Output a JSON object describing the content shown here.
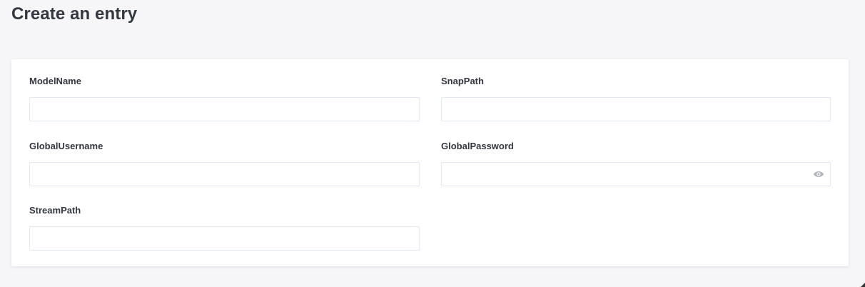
{
  "header": {
    "title": "Create an entry"
  },
  "form": {
    "fields": [
      {
        "label": "ModelName",
        "value": "",
        "placeholder": ""
      },
      {
        "label": "SnapPath",
        "value": "",
        "placeholder": ""
      },
      {
        "label": "GlobalUsername",
        "value": "",
        "placeholder": ""
      },
      {
        "label": "GlobalPassword",
        "value": "",
        "placeholder": "",
        "icon": "eye-icon"
      },
      {
        "label": "StreamPath",
        "value": "",
        "placeholder": ""
      }
    ]
  },
  "colors": {
    "background": "#f6f6f9",
    "card": "#ffffff",
    "input_border": "#e3e9f3",
    "text": "#333740",
    "icon": "#b3b5b9"
  }
}
